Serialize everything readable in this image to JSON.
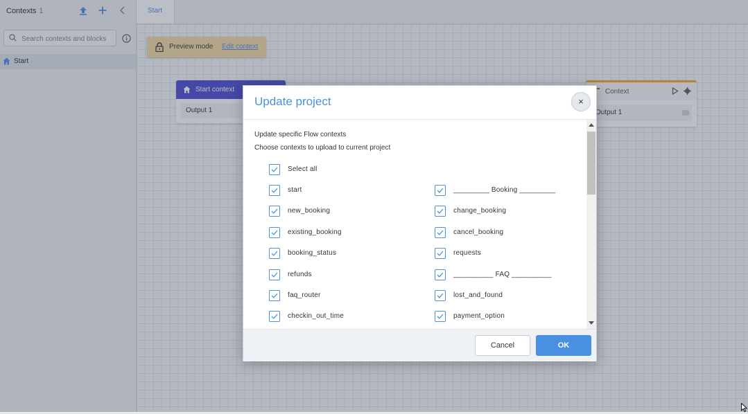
{
  "sidebar": {
    "title": "Contexts",
    "count": "1",
    "search": {
      "placeholder": "Search contexts and blocks"
    },
    "items": [
      {
        "label": "Start"
      }
    ]
  },
  "tabs": [
    {
      "label": "Start"
    }
  ],
  "canvas": {
    "preview": {
      "mode_label": "Preview mode",
      "edit_link": "Edit context"
    },
    "start_node": {
      "title": "Start context",
      "output": "Output 1"
    },
    "context_node": {
      "title": "Context",
      "output": "Output 1"
    }
  },
  "modal": {
    "title": "Update project",
    "close_symbol": "×",
    "description1": "Update specific Flow contexts",
    "description2": "Choose contexts to upload to current project",
    "select_all": {
      "label": "Select all",
      "checked": true
    },
    "left_items": [
      {
        "label": "start",
        "checked": true
      },
      {
        "label": "new_booking",
        "checked": true
      },
      {
        "label": "existing_booking",
        "checked": true
      },
      {
        "label": "booking_status",
        "checked": true
      },
      {
        "label": "refunds",
        "checked": true
      },
      {
        "label": "faq_router",
        "checked": true
      },
      {
        "label": "checkin_out_time",
        "checked": true
      }
    ],
    "right_items": [
      {
        "label": "_________ Booking _________",
        "checked": true
      },
      {
        "label": "change_booking",
        "checked": true
      },
      {
        "label": "cancel_booking",
        "checked": true
      },
      {
        "label": "requests",
        "checked": true
      },
      {
        "label": "__________ FAQ __________",
        "checked": true
      },
      {
        "label": "lost_and_found",
        "checked": true
      },
      {
        "label": "payment_option",
        "checked": true
      }
    ],
    "cancel_label": "Cancel",
    "ok_label": "OK"
  },
  "colors": {
    "accent": "#4a90e2",
    "start_node_header": "#4b4bd1",
    "preview_banner": "#f3d9a6",
    "context_node_accent": "#f5a623"
  }
}
